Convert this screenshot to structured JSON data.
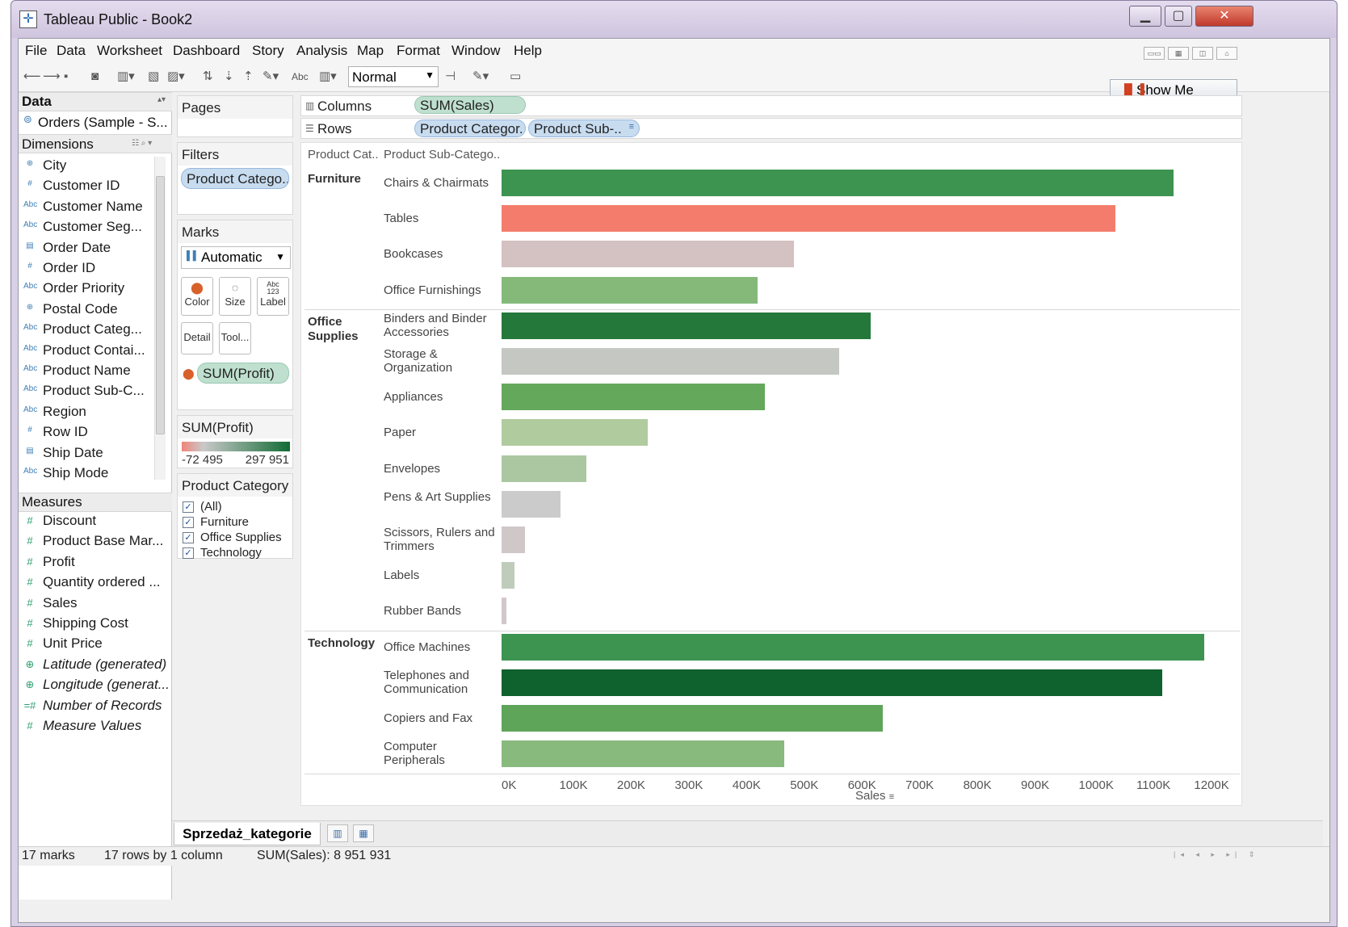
{
  "window": {
    "title": "Tableau Public - Book2"
  },
  "menu": [
    "File",
    "Data",
    "Worksheet",
    "Dashboard",
    "Story",
    "Analysis",
    "Map",
    "Format",
    "Window",
    "Help"
  ],
  "toolbar": {
    "fit": "Normal",
    "abc_label": "Abc",
    "show_me": "Show Me"
  },
  "data_pane": {
    "title": "Data",
    "datasource": "Orders (Sample - S...",
    "dimensions_title": "Dimensions",
    "dimensions": [
      {
        "label": "City",
        "icon": "globe-icon",
        "glyph": "⊕"
      },
      {
        "label": "Customer ID",
        "icon": "hash-icon",
        "glyph": "#"
      },
      {
        "label": "Customer Name",
        "icon": "abc-icon",
        "glyph": "Abc"
      },
      {
        "label": "Customer Seg...",
        "icon": "abc-icon",
        "glyph": "Abc"
      },
      {
        "label": "Order Date",
        "icon": "calendar-icon",
        "glyph": "▤"
      },
      {
        "label": "Order ID",
        "icon": "hash-icon",
        "glyph": "#"
      },
      {
        "label": "Order Priority",
        "icon": "abc-icon",
        "glyph": "Abc"
      },
      {
        "label": "Postal Code",
        "icon": "globe-icon",
        "glyph": "⊕"
      },
      {
        "label": "Product Categ...",
        "icon": "abc-icon",
        "glyph": "Abc"
      },
      {
        "label": "Product Contai...",
        "icon": "abc-icon",
        "glyph": "Abc"
      },
      {
        "label": "Product Name",
        "icon": "abc-icon",
        "glyph": "Abc"
      },
      {
        "label": "Product Sub-C...",
        "icon": "abc-icon",
        "glyph": "Abc"
      },
      {
        "label": "Region",
        "icon": "abc-icon",
        "glyph": "Abc"
      },
      {
        "label": "Row ID",
        "icon": "hash-icon",
        "glyph": "#"
      },
      {
        "label": "Ship Date",
        "icon": "calendar-icon",
        "glyph": "▤"
      },
      {
        "label": "Ship Mode",
        "icon": "abc-icon",
        "glyph": "Abc"
      }
    ],
    "measures_title": "Measures",
    "measures": [
      {
        "label": "Discount",
        "icon": "hash-icon",
        "glyph": "#",
        "italic": false
      },
      {
        "label": "Product Base Mar...",
        "icon": "hash-icon",
        "glyph": "#",
        "italic": false
      },
      {
        "label": "Profit",
        "icon": "hash-icon",
        "glyph": "#",
        "italic": false
      },
      {
        "label": "Quantity ordered ...",
        "icon": "hash-icon",
        "glyph": "#",
        "italic": false
      },
      {
        "label": "Sales",
        "icon": "hash-icon",
        "glyph": "#",
        "italic": false
      },
      {
        "label": "Shipping Cost",
        "icon": "hash-icon",
        "glyph": "#",
        "italic": false
      },
      {
        "label": "Unit Price",
        "icon": "hash-icon",
        "glyph": "#",
        "italic": false
      },
      {
        "label": "Latitude (generated)",
        "icon": "globe-icon",
        "glyph": "⊕",
        "italic": true
      },
      {
        "label": "Longitude (generat...",
        "icon": "globe-icon",
        "glyph": "⊕",
        "italic": true
      },
      {
        "label": "Number of Records",
        "icon": "hash-icon",
        "glyph": "=#",
        "italic": true
      },
      {
        "label": "Measure Values",
        "icon": "hash-icon",
        "glyph": "#",
        "italic": true
      }
    ]
  },
  "cards": {
    "pages_title": "Pages",
    "filters_title": "Filters",
    "filter_pill": "Product Catego..",
    "marks_title": "Marks",
    "mark_type": "Automatic",
    "mark_buttons": {
      "color": "Color",
      "size": "Size",
      "label": "Label",
      "detail": "Detail",
      "tooltip": "Tool..."
    },
    "label_glyph": "Abc\n123",
    "color_pill": "SUM(Profit)",
    "legend_title": "SUM(Profit)",
    "legend_min": "-72 495",
    "legend_max": "297 951",
    "legend_colors": {
      "low": "#f0857a",
      "mid": "#c9c9c9",
      "high": "#126b35"
    },
    "qf_title": "Product Category",
    "qf_items": [
      "(All)",
      "Furniture",
      "Office Supplies",
      "Technology"
    ]
  },
  "shelves": {
    "columns_label": "Columns",
    "columns_pill": "SUM(Sales)",
    "rows_label": "Rows",
    "rows_pills": [
      "Product Categor..",
      "Product Sub-.."
    ]
  },
  "chart_data": {
    "type": "bar",
    "orientation": "horizontal",
    "header_cat": "Product Cat..",
    "header_sub": "Product Sub-Catego..",
    "xlabel": "Sales",
    "xlim": [
      0,
      1260000
    ],
    "ticks": [
      {
        "value": 0,
        "label": "0K"
      },
      {
        "value": 100000,
        "label": "100K"
      },
      {
        "value": 200000,
        "label": "200K"
      },
      {
        "value": 300000,
        "label": "300K"
      },
      {
        "value": 400000,
        "label": "400K"
      },
      {
        "value": 500000,
        "label": "500K"
      },
      {
        "value": 600000,
        "label": "600K"
      },
      {
        "value": 700000,
        "label": "700K"
      },
      {
        "value": 800000,
        "label": "800K"
      },
      {
        "value": 900000,
        "label": "900K"
      },
      {
        "value": 1000000,
        "label": "1000K"
      },
      {
        "value": 1100000,
        "label": "1100K"
      },
      {
        "value": 1200000,
        "label": "1200K"
      }
    ],
    "categories": [
      {
        "label": "Furniture",
        "rows": [
          {
            "sub": "Chairs & Chairmats",
            "value": 1165000,
            "color": "#3d9450"
          },
          {
            "sub": "Tables",
            "value": 1063000,
            "color": "#f47c6c"
          },
          {
            "sub": "Bookcases",
            "value": 507000,
            "color": "#d4c1c2"
          },
          {
            "sub": "Office Furnishings",
            "value": 444000,
            "color": "#84b97a"
          }
        ]
      },
      {
        "label": "Office Supplies",
        "rows": [
          {
            "sub": "Binders and Binder Accessories",
            "value": 639000,
            "color": "#24783a"
          },
          {
            "sub": "Storage & Organization",
            "value": 585000,
            "color": "#c4c7c2"
          },
          {
            "sub": "Appliances",
            "value": 456000,
            "color": "#64a85c"
          },
          {
            "sub": "Paper",
            "value": 254000,
            "color": "#b0cb9e"
          },
          {
            "sub": "Envelopes",
            "value": 147000,
            "color": "#aac7a2"
          },
          {
            "sub": "Pens & Art Supplies",
            "value": 102000,
            "color": "#cbcbcb"
          },
          {
            "sub": "Scissors, Rulers and Trimmers",
            "value": 40000,
            "color": "#d0c8c8"
          },
          {
            "sub": "Labels",
            "value": 22000,
            "color": "#bfccbb"
          },
          {
            "sub": "Rubber Bands",
            "value": 8000,
            "color": "#d2c8c9"
          }
        ]
      },
      {
        "label": "Technology",
        "rows": [
          {
            "sub": "Office Machines",
            "value": 1218000,
            "color": "#3d9450"
          },
          {
            "sub": "Telephones and Communication",
            "value": 1145000,
            "color": "#0f612e"
          },
          {
            "sub": "Copiers and Fax",
            "value": 661000,
            "color": "#5ea55a"
          },
          {
            "sub": "Computer Peripherals",
            "value": 490000,
            "color": "#88ba7e"
          }
        ]
      }
    ]
  },
  "tabs": {
    "sheet": "Sprzedaż_kategorie"
  },
  "status": {
    "marks": "17 marks",
    "dims": "17 rows by 1 column",
    "sum": "SUM(Sales): 8 951 931"
  }
}
